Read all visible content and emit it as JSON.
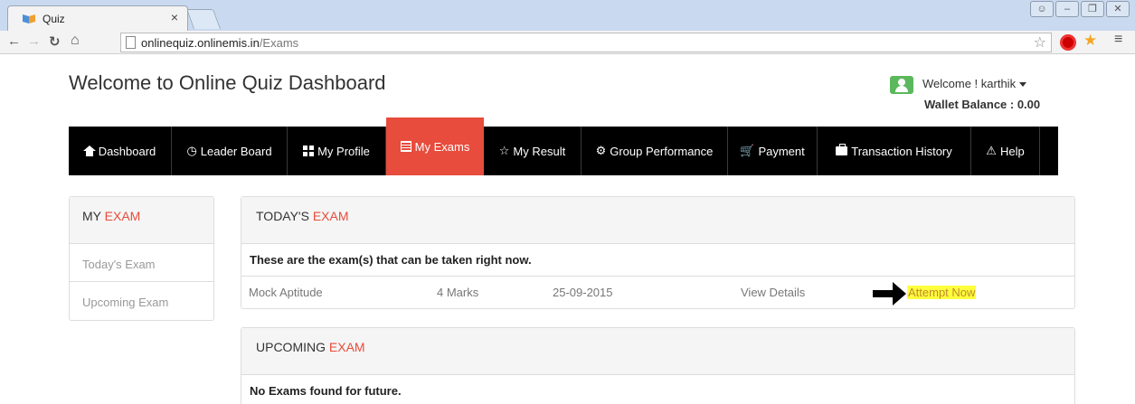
{
  "browser": {
    "tab_title": "Quiz",
    "tab_close": "×",
    "url_domain": "onlinequiz.onlinemis.in",
    "url_path": "/Exams"
  },
  "header": {
    "title": "Welcome to Online Quiz Dashboard",
    "welcome": "Welcome ! karthik",
    "wallet": "Wallet Balance : 0.00"
  },
  "nav": {
    "items": [
      {
        "label": "Dashboard",
        "icon": "home-icon"
      },
      {
        "label": "Leader Board",
        "icon": "clock-icon"
      },
      {
        "label": "My Profile",
        "icon": "grid-icon"
      },
      {
        "label": "My Exams",
        "icon": "list-icon",
        "active": true
      },
      {
        "label": "My Result",
        "icon": "star-icon"
      },
      {
        "label": "Group Performance",
        "icon": "gear-icon"
      },
      {
        "label": "Payment",
        "icon": "cart-icon"
      },
      {
        "label": "Transaction History",
        "icon": "briefcase-icon"
      },
      {
        "label": "Help",
        "icon": "warning-icon"
      }
    ],
    "active_color": "#e74c3c"
  },
  "sidebar": {
    "head_prefix": "MY",
    "head_accent": "EXAM",
    "links": [
      "Today's Exam",
      "Upcoming Exam"
    ]
  },
  "today": {
    "head_prefix": "TODAY'S",
    "head_accent": "EXAM",
    "note": "These are the exam(s) that can be taken right now.",
    "rows": [
      {
        "name": "Mock Aptitude",
        "marks": "4 Marks",
        "date": "25-09-2015",
        "details": "View Details",
        "action": "Attempt Now"
      }
    ]
  },
  "upcoming": {
    "head_prefix": "UPCOMING",
    "head_accent": "EXAM",
    "note": "No Exams found for future."
  }
}
